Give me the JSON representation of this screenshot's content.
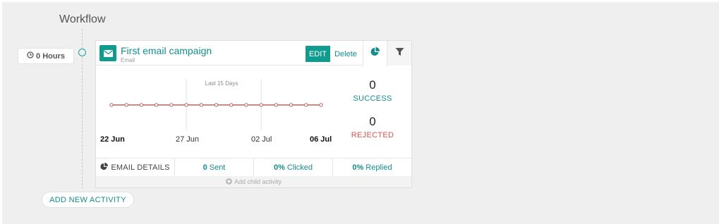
{
  "workflow": {
    "title": "Workflow"
  },
  "delay": {
    "label": "0 Hours",
    "icon": "clock-icon"
  },
  "campaign": {
    "name": "First email campaign",
    "type": "Email",
    "icon": "envelope-icon",
    "edit_label": "EDIT",
    "delete_label": "Delete",
    "tab_icons": [
      "pie-chart-icon",
      "filter-icon"
    ]
  },
  "chart_data": {
    "type": "line",
    "subtitle": "Last 15 Days",
    "x_tick_labels": [
      "22 Jun",
      "27 Jun",
      "02 Jul",
      "06 Jul"
    ],
    "x": [
      "22 Jun",
      "23 Jun",
      "24 Jun",
      "25 Jun",
      "26 Jun",
      "27 Jun",
      "28 Jun",
      "29 Jun",
      "30 Jun",
      "01 Jul",
      "02 Jul",
      "03 Jul",
      "04 Jul",
      "05 Jul",
      "06 Jul"
    ],
    "series": [
      {
        "values": [
          0,
          0,
          0,
          0,
          0,
          0,
          0,
          0,
          0,
          0,
          0,
          0,
          0,
          0,
          0
        ]
      }
    ],
    "line_color": "#b5665f",
    "ylim": [
      0,
      1
    ]
  },
  "stats": {
    "success": {
      "value": "0",
      "label": "SUCCESS",
      "color": "#138d8d"
    },
    "rejected": {
      "value": "0",
      "label": "REJECTED",
      "color": "#d9534f"
    }
  },
  "email_details": {
    "label": "EMAIL DETAILS",
    "sent": {
      "value": "0",
      "label": "Sent"
    },
    "clicked": {
      "value": "0%",
      "label": "Clicked"
    },
    "replied": {
      "value": "0%",
      "label": "Replied"
    }
  },
  "add_child_label": "Add child activity",
  "add_activity_label": "ADD NEW ACTIVITY",
  "accent_color": "#0f9b8e"
}
